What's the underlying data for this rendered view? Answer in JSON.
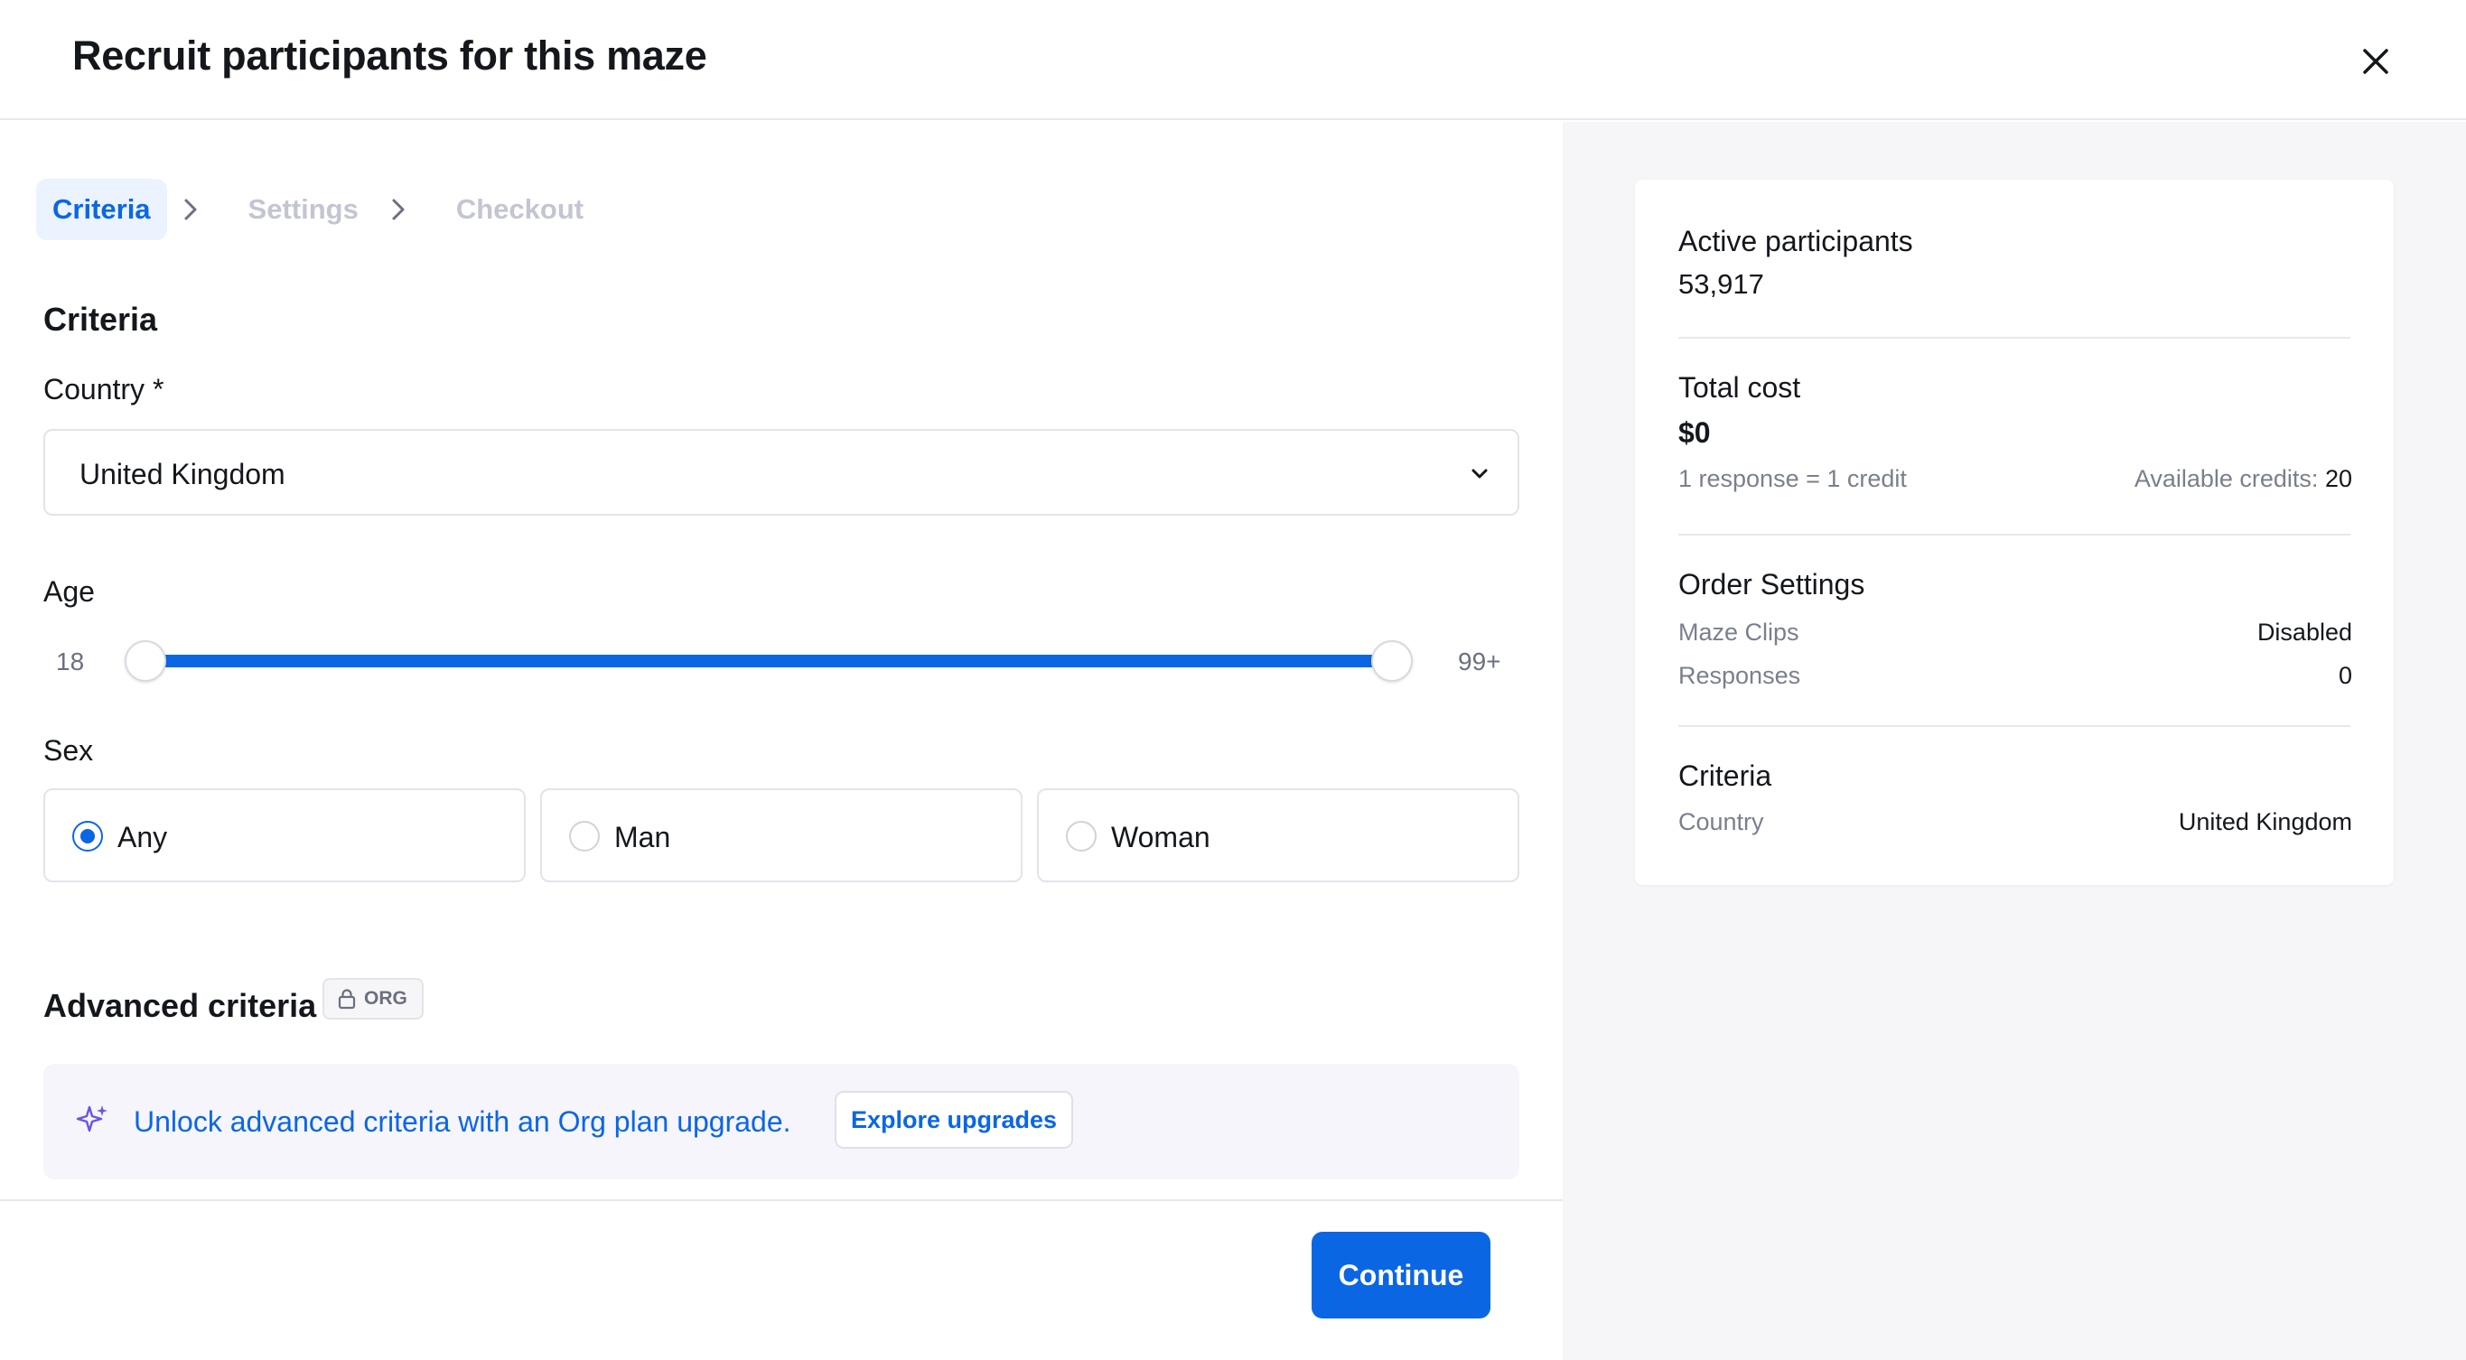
{
  "header": {
    "title": "Recruit participants for this maze"
  },
  "steps": [
    {
      "label": "Criteria",
      "active": true
    },
    {
      "label": "Settings",
      "active": false
    },
    {
      "label": "Checkout",
      "active": false
    }
  ],
  "criteria": {
    "section_title": "Criteria",
    "country_label": "Country *",
    "country_value": "United Kingdom",
    "age_label": "Age",
    "age_min": "18",
    "age_max": "99+",
    "sex_label": "Sex",
    "sex_options": [
      {
        "label": "Any",
        "checked": true
      },
      {
        "label": "Man",
        "checked": false
      },
      {
        "label": "Woman",
        "checked": false
      }
    ]
  },
  "advanced": {
    "title": "Advanced criteria",
    "badge": "ORG",
    "message": "Unlock advanced criteria with an Org plan upgrade.",
    "button": "Explore upgrades"
  },
  "footer": {
    "continue_label": "Continue"
  },
  "summary": {
    "active_participants_label": "Active participants",
    "active_participants_value": "53,917",
    "total_cost_label": "Total cost",
    "total_cost_value": "$0",
    "rate_text": "1 response = 1 credit",
    "available_credits_label": "Available credits:",
    "available_credits_value": "20",
    "order_settings_label": "Order Settings",
    "maze_clips_label": "Maze Clips",
    "maze_clips_value": "Disabled",
    "responses_label": "Responses",
    "responses_value": "0",
    "criteria_label": "Criteria",
    "country_label": "Country",
    "country_value": "United Kingdom"
  },
  "colors": {
    "accent": "#0b66e4",
    "panel_bg": "#f6f6f8",
    "upgrade_bg": "#f5f5fb",
    "muted_text": "#7a7f8d",
    "disabled_step": "#c3c6d0"
  },
  "icons": {
    "close": "close-icon",
    "step_separator": "chevron-right-icon",
    "select_caret": "chevron-down-icon",
    "badge": "lock-icon",
    "upgrade": "sparkle-icon"
  }
}
